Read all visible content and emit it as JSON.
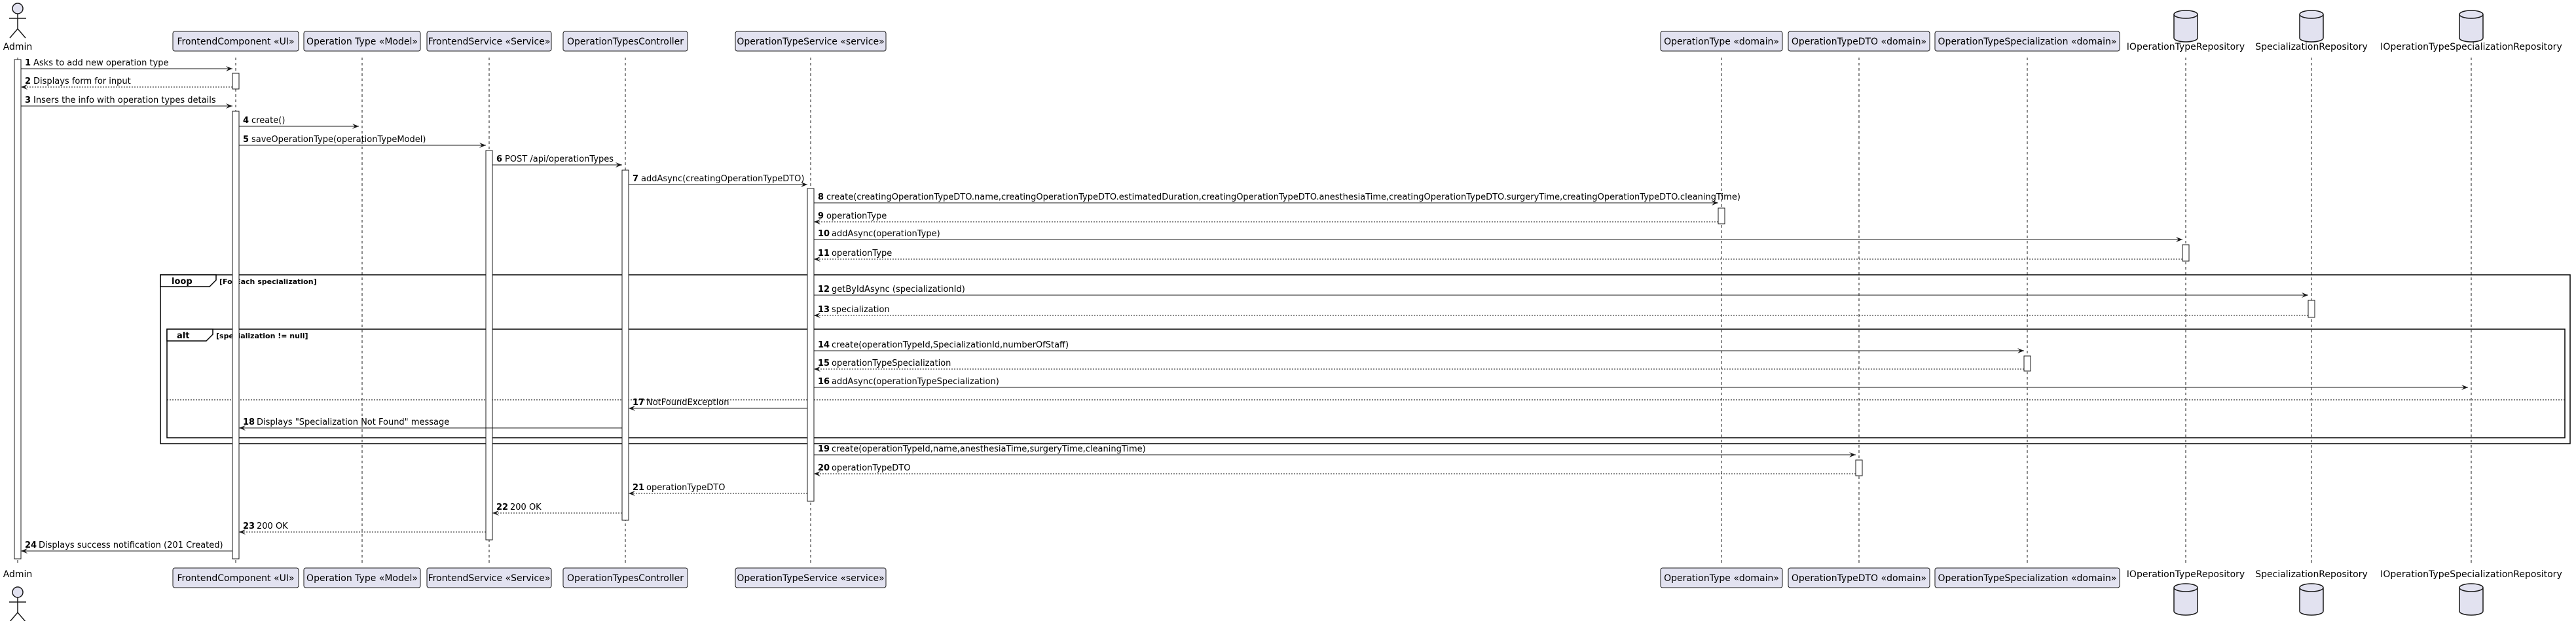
{
  "participants": [
    {
      "id": "admin",
      "label": "Admin",
      "kind": "actor"
    },
    {
      "id": "frontend_component",
      "label": "FrontendComponent «UI»",
      "kind": "participant"
    },
    {
      "id": "operation_type_model",
      "label": "Operation Type «Model»",
      "kind": "participant"
    },
    {
      "id": "frontend_service",
      "label": "FrontendService «Service»",
      "kind": "participant"
    },
    {
      "id": "operation_types_controller",
      "label": "OperationTypesController",
      "kind": "participant"
    },
    {
      "id": "operation_type_service",
      "label": "OperationTypeService «service»",
      "kind": "participant"
    },
    {
      "id": "operation_type_domain",
      "label": "OperationType «domain»",
      "kind": "participant"
    },
    {
      "id": "operation_type_dto",
      "label": "OperationTypeDTO «domain»",
      "kind": "participant"
    },
    {
      "id": "operation_type_specialization_domain",
      "label": "OperationTypeSpecialization «domain»",
      "kind": "participant"
    },
    {
      "id": "ioperation_type_repository",
      "label": "IOperationTypeRepository",
      "kind": "database"
    },
    {
      "id": "specialization_repository",
      "label": "SpecializationRepository",
      "kind": "database"
    },
    {
      "id": "ioperation_type_specialization_repository",
      "label": "IOperationTypeSpecializationRepository",
      "kind": "database"
    }
  ],
  "messages": [
    {
      "num": "1",
      "text": "Asks to add new operation type",
      "from": "admin",
      "to": "frontend_component",
      "style": "solid"
    },
    {
      "num": "2",
      "text": "Displays form for input",
      "from": "frontend_component",
      "to": "admin",
      "style": "dashed"
    },
    {
      "num": "3",
      "text": "Insers the info with operation types details",
      "from": "admin",
      "to": "frontend_component",
      "style": "solid"
    },
    {
      "num": "4",
      "text": "create()",
      "from": "frontend_component",
      "to": "operation_type_model",
      "style": "solid"
    },
    {
      "num": "5",
      "text": "saveOperationType(operationTypeModel)",
      "from": "frontend_component",
      "to": "frontend_service",
      "style": "solid"
    },
    {
      "num": "6",
      "text": "POST /api/operationTypes",
      "from": "frontend_service",
      "to": "operation_types_controller",
      "style": "solid"
    },
    {
      "num": "7",
      "text": "addAsync(creatingOperationTypeDTO)",
      "from": "operation_types_controller",
      "to": "operation_type_service",
      "style": "solid"
    },
    {
      "num": "8",
      "text": "create(creatingOperationTypeDTO.name,creatingOperationTypeDTO.estimatedDuration,creatingOperationTypeDTO.anesthesiaTime,creatingOperationTypeDTO.surgeryTime,creatingOperationTypeDTO.cleaningTime)",
      "from": "operation_type_service",
      "to": "operation_type_domain",
      "style": "solid"
    },
    {
      "num": "9",
      "text": "operationType",
      "from": "operation_type_domain",
      "to": "operation_type_service",
      "style": "dashed"
    },
    {
      "num": "10",
      "text": "addAsync(operationType)",
      "from": "operation_type_service",
      "to": "ioperation_type_repository",
      "style": "solid"
    },
    {
      "num": "11",
      "text": "operationType",
      "from": "ioperation_type_repository",
      "to": "operation_type_service",
      "style": "dashed"
    },
    {
      "num": "12",
      "text": "getByIdAsync (specializationId)",
      "from": "operation_type_service",
      "to": "specialization_repository",
      "style": "solid"
    },
    {
      "num": "13",
      "text": "specialization",
      "from": "specialization_repository",
      "to": "operation_type_service",
      "style": "dashed"
    },
    {
      "num": "14",
      "text": "create(operationTypeId,SpecializationId,numberOfStaff)",
      "from": "operation_type_service",
      "to": "operation_type_specialization_domain",
      "style": "solid"
    },
    {
      "num": "15",
      "text": "operationTypeSpecialization",
      "from": "operation_type_specialization_domain",
      "to": "operation_type_service",
      "style": "dashed"
    },
    {
      "num": "16",
      "text": "addAsync(operationTypeSpecialization)",
      "from": "operation_type_service",
      "to": "ioperation_type_specialization_repository",
      "style": "solid"
    },
    {
      "num": "17",
      "text": "NotFoundException",
      "from": "operation_type_service",
      "to": "operation_types_controller",
      "style": "solid"
    },
    {
      "num": "18",
      "text": "Displays \"Specialization Not Found\" message",
      "from": "operation_types_controller",
      "to": "frontend_component",
      "style": "solid"
    },
    {
      "num": "19",
      "text": "create(operationTypeId,name,anesthesiaTime,surgeryTime,cleaningTime)",
      "from": "operation_type_service",
      "to": "operation_type_dto",
      "style": "solid"
    },
    {
      "num": "20",
      "text": "operationTypeDTO",
      "from": "operation_type_dto",
      "to": "operation_type_service",
      "style": "dashed"
    },
    {
      "num": "21",
      "text": "operationTypeDTO",
      "from": "operation_type_service",
      "to": "operation_types_controller",
      "style": "dashed"
    },
    {
      "num": "22",
      "text": "200 OK",
      "from": "operation_types_controller",
      "to": "frontend_service",
      "style": "dashed"
    },
    {
      "num": "23",
      "text": "200 OK",
      "from": "frontend_service",
      "to": "frontend_component",
      "style": "dashed"
    },
    {
      "num": "24",
      "text": "Displays success notification (201 Created)",
      "from": "frontend_component",
      "to": "admin",
      "style": "solid"
    }
  ],
  "fragments": {
    "loop": {
      "keyword": "loop",
      "condition": "[ForEach specialization]"
    },
    "alt": {
      "keyword": "alt",
      "condition": "[specialization != null]"
    }
  },
  "colors": {
    "participant_fill": "#E2E2F0",
    "participant_border": "#181818",
    "lifeline": "#181818",
    "activation_fill": "#FFFFFF"
  }
}
